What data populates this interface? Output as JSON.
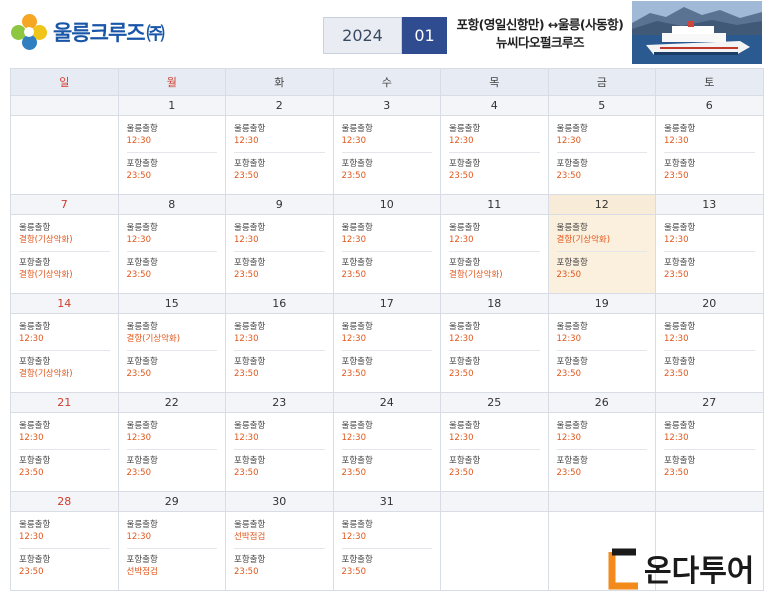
{
  "header": {
    "brand_name": "울릉크루즈",
    "brand_suffix": "㈜",
    "year": "2024",
    "month": "01",
    "route_line1": "포항(영일신항만) ↔울릉(사동항)",
    "route_line2": "뉴씨다오펄크루즈"
  },
  "weekdays": [
    "일",
    "월",
    "화",
    "수",
    "목",
    "금",
    "토"
  ],
  "labels": {
    "depart_ulleung": "울릉출항",
    "depart_pohang": "포항출항"
  },
  "weeks": [
    [
      {
        "date": "",
        "u": "",
        "p": ""
      },
      {
        "date": "1",
        "u": "12:30",
        "p": "23:50"
      },
      {
        "date": "2",
        "u": "12:30",
        "p": "23:50"
      },
      {
        "date": "3",
        "u": "12:30",
        "p": "23:50"
      },
      {
        "date": "4",
        "u": "12:30",
        "p": "23:50"
      },
      {
        "date": "5",
        "u": "12:30",
        "p": "23:50"
      },
      {
        "date": "6",
        "u": "12:30",
        "p": "23:50"
      }
    ],
    [
      {
        "date": "7",
        "u": "결항(기상악화)",
        "p": "결항(기상악화)"
      },
      {
        "date": "8",
        "u": "12:30",
        "p": "23:50"
      },
      {
        "date": "9",
        "u": "12:30",
        "p": "23:50"
      },
      {
        "date": "10",
        "u": "12:30",
        "p": "23:50"
      },
      {
        "date": "11",
        "u": "12:30",
        "p": "결항(기상악화)"
      },
      {
        "date": "12",
        "u": "결항(기상악화)",
        "p": "23:50",
        "highlight": true
      },
      {
        "date": "13",
        "u": "12:30",
        "p": "23:50"
      }
    ],
    [
      {
        "date": "14",
        "u": "12:30",
        "p": "결항(기상악화)"
      },
      {
        "date": "15",
        "u": "결항(기상악화)",
        "p": "23:50"
      },
      {
        "date": "16",
        "u": "12:30",
        "p": "23:50"
      },
      {
        "date": "17",
        "u": "12:30",
        "p": "23:50"
      },
      {
        "date": "18",
        "u": "12:30",
        "p": "23:50"
      },
      {
        "date": "19",
        "u": "12:30",
        "p": "23:50"
      },
      {
        "date": "20",
        "u": "12:30",
        "p": "23:50"
      }
    ],
    [
      {
        "date": "21",
        "u": "12:30",
        "p": "23:50"
      },
      {
        "date": "22",
        "u": "12:30",
        "p": "23:50"
      },
      {
        "date": "23",
        "u": "12:30",
        "p": "23:50"
      },
      {
        "date": "24",
        "u": "12:30",
        "p": "23:50"
      },
      {
        "date": "25",
        "u": "12:30",
        "p": "23:50"
      },
      {
        "date": "26",
        "u": "12:30",
        "p": "23:50"
      },
      {
        "date": "27",
        "u": "12:30",
        "p": "23:50"
      }
    ],
    [
      {
        "date": "28",
        "u": "12:30",
        "p": "23:50"
      },
      {
        "date": "29",
        "u": "12:30",
        "p": "선박점검"
      },
      {
        "date": "30",
        "u": "선박점검",
        "p": "23:50"
      },
      {
        "date": "31",
        "u": "12:30",
        "p": "23:50"
      },
      {
        "date": "",
        "u": "",
        "p": ""
      },
      {
        "date": "",
        "u": "",
        "p": ""
      },
      {
        "date": "",
        "u": "",
        "p": ""
      }
    ]
  ],
  "watermark": {
    "text": "다온다투어",
    "color": "#1a1a1a",
    "accent": "#f28a1c"
  },
  "colors": {
    "accent_red": "#d23b2b",
    "time_orange": "#e0571c",
    "month_blue": "#2e4c8f",
    "brand_blue": "#1a56a8",
    "highlight": "#fbf0de"
  }
}
